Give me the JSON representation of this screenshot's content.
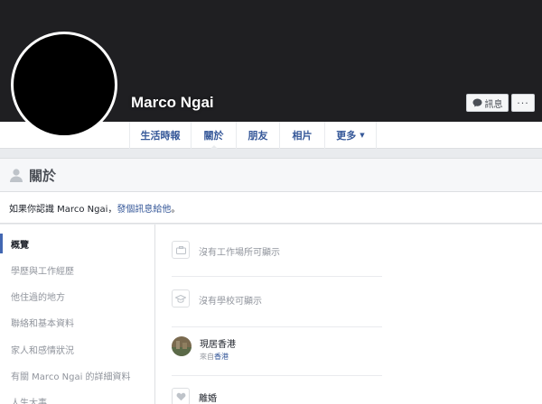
{
  "profile": {
    "name": "Marco Ngai",
    "message_label": "訊息",
    "more_label": "···"
  },
  "tabs": [
    {
      "label": "生活時報"
    },
    {
      "label": "關於"
    },
    {
      "label": "朋友"
    },
    {
      "label": "相片"
    },
    {
      "label": "更多"
    }
  ],
  "about": {
    "title": "關於",
    "intro_prefix": "如果你認識 Marco Ngai，",
    "intro_link": "發個訊息給他",
    "intro_suffix": "。"
  },
  "left_nav": [
    {
      "label": "概覽"
    },
    {
      "label": "學歷與工作經歷"
    },
    {
      "label": "他住過的地方"
    },
    {
      "label": "聯絡和基本資料"
    },
    {
      "label": "家人和感情狀況"
    },
    {
      "label": "有關 Marco Ngai 的詳細資料"
    },
    {
      "label": "人生大事"
    }
  ],
  "overview": {
    "work": "沒有工作場所可顯示",
    "school": "沒有學校可顯示",
    "location_main": "現居香港",
    "location_sub_prefix": "來自",
    "location_sub_link": "香港",
    "relationship": "離婚"
  },
  "colors": {
    "cover": "#1f1f22",
    "link": "#365899",
    "accent": "#4267b2"
  }
}
